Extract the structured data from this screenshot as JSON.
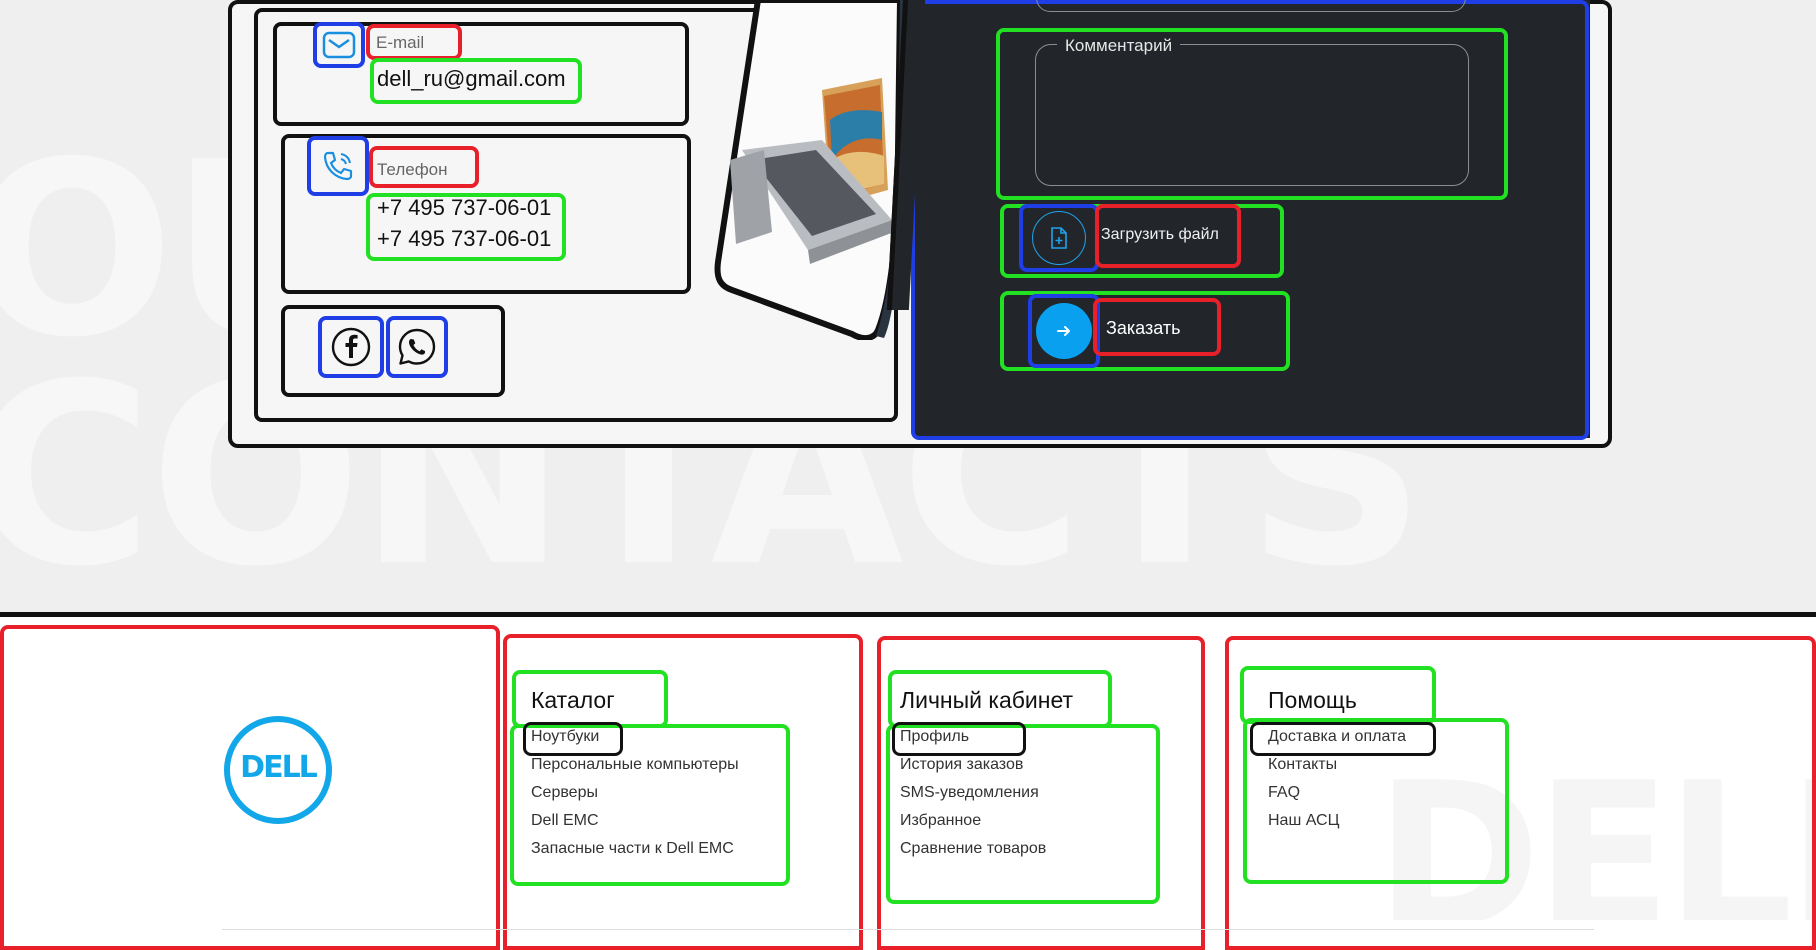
{
  "background": {
    "word_top": "OUR",
    "word_bottom": "CONTACTS",
    "footer_word": "DELL"
  },
  "contacts": {
    "email_label": "E-mail",
    "email_value": "dell_ru@gmail.com",
    "phone_label": "Телефон",
    "phones": [
      "+7 495 737-06-01",
      "+7 495 737-06-01"
    ],
    "social": [
      "facebook-icon",
      "whatsapp-icon"
    ]
  },
  "form": {
    "comment_label": "Комментарий",
    "comment_value": "",
    "upload_label": "Загрузить файл",
    "order_label": "Заказать"
  },
  "footer": {
    "logo_text": "DELL",
    "columns": [
      {
        "heading": "Каталог",
        "links": [
          "Ноутбуки",
          "Персональные компьютеры",
          "Серверы",
          "Dell EMC",
          "Запасные части к Dell EMC"
        ]
      },
      {
        "heading": "Личный кабинет",
        "links": [
          "Профиль",
          "История заказов",
          "SMS-уведомления",
          "Избранное",
          "Сравнение товаров"
        ]
      },
      {
        "heading": "Помощь",
        "links": [
          "Доставка и оплата",
          "Контакты",
          "FAQ",
          "Наш АСЦ"
        ]
      }
    ]
  },
  "colors": {
    "accent": "#0aa0f0",
    "dark_panel": "#22262b",
    "dell_blue": "#12a7e8"
  }
}
